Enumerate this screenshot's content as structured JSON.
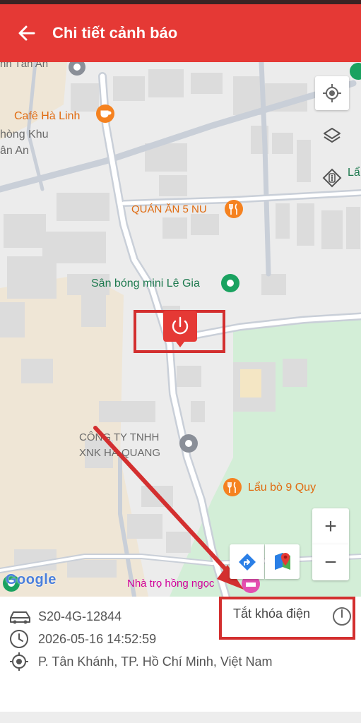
{
  "header": {
    "title": "Chi tiết cảnh báo",
    "color": "#e53935"
  },
  "map": {
    "places": {
      "tan_an_top": "nh Tân An",
      "cafe": "Cafê Hà Linh",
      "phong_khu": "hòng Khu",
      "tan_an_left": "ân An",
      "quan_an": "QUÁN ĂN 5 NU",
      "san_bong": "Sân bóng mini Lê Gia",
      "cong_ty_1": "CÔNG TY TNHH",
      "cong_ty_2": "XNK HÀ QUANG",
      "lau_bo": "Lẩu bò 9 Quy",
      "nha_tro": "Nhà trọ hồng ngọc",
      "lau_right": "Lẩ"
    },
    "google_logo": "Google",
    "zoom_in": "+",
    "zoom_out": "−",
    "icons": [
      "my-location-icon",
      "layers-icon",
      "traffic-icon",
      "directions-icon",
      "google-maps-icon",
      "power-marker-icon"
    ]
  },
  "vehicle": {
    "plate": "S20-4G-12844",
    "time": "2026-05-16 14:52:59",
    "address": "P. Tân Khánh, TP. Hồ Chí Minh, Việt Nam",
    "action_label": "Tắt khóa điện"
  },
  "colors": {
    "accent": "#e53935",
    "highlight_box": "#d32f2f",
    "park": "#d3eed7",
    "label_orange": "#e06b10",
    "label_green": "#1e7a4f",
    "label_gray": "#6a6a6a"
  }
}
